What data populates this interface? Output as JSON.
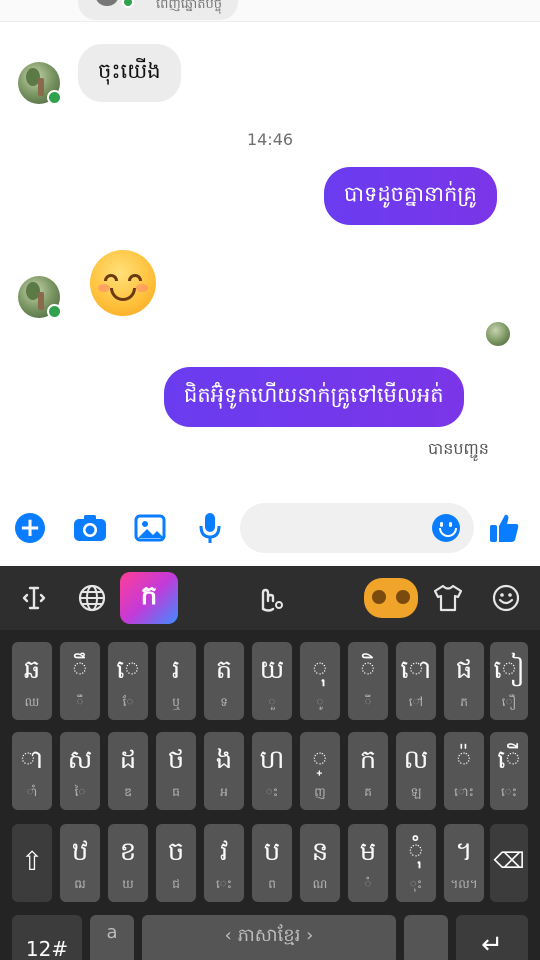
{
  "chat": {
    "top_partial_text": "ពេញឆ្នោតបច្ចុ",
    "incoming_1": "ចុះយើង",
    "time": "14:46",
    "outgoing_1": "បាទដូចគ្នានាក់គ្រូ",
    "incoming_emoji": "smiling-face-with-smiling-eyes",
    "outgoing_2": "ជិតអ៊ុំទូកហើយនាក់គ្រូទៅមើលអត់",
    "status": "បានបញ្ជូន",
    "colors": {
      "outgoing_bubble": "#6a3cf0",
      "incoming_bubble": "#ececec",
      "online": "#31a24c"
    }
  },
  "composer": {
    "input_value": "",
    "icons": [
      "add-icon",
      "camera-icon",
      "image-icon",
      "microphone-icon",
      "emoji-icon",
      "thumbs-up-icon"
    ],
    "accent": "#0a7cff"
  },
  "keyboard": {
    "toolbar_icons": [
      "text-cursor-icon",
      "globe-icon",
      "sticker-icon",
      "gesture-icon",
      "gamepad-icon",
      "theme-shirt-icon",
      "emoji-icon"
    ],
    "sticker_label": "ក",
    "row1": [
      {
        "m": "ឆ",
        "s": "ឈ"
      },
      {
        "m": "ឹ",
        "s": "ឺ"
      },
      {
        "m": "េ",
        "s": "ែ"
      },
      {
        "m": "រ",
        "s": "ឬ"
      },
      {
        "m": "ត",
        "s": "ទ"
      },
      {
        "m": "យ",
        "s": "ួ"
      },
      {
        "m": "ុ",
        "s": "ូ"
      },
      {
        "m": "ិ",
        "s": "ី"
      },
      {
        "m": "ោ",
        "s": "ៅ"
      },
      {
        "m": "ផ",
        "s": "ភ"
      },
      {
        "m": "ៀ",
        "s": "ឿ"
      }
    ],
    "row2": [
      {
        "m": "ា",
        "s": "ាំ"
      },
      {
        "m": "ស",
        "s": "ៃ"
      },
      {
        "m": "ដ",
        "s": "ឌ"
      },
      {
        "m": "ថ",
        "s": "ធ"
      },
      {
        "m": "ង",
        "s": "អ"
      },
      {
        "m": "ហ",
        "s": "ះ"
      },
      {
        "m": "្",
        "s": "ញ"
      },
      {
        "m": "ក",
        "s": "គ"
      },
      {
        "m": "ល",
        "s": "ឡ"
      },
      {
        "m": "៉",
        "s": "ោះ"
      },
      {
        "m": "ើ",
        "s": "េះ"
      }
    ],
    "row3": [
      {
        "m": "ឋ",
        "s": "ឍ"
      },
      {
        "m": "ខ",
        "s": "ឃ"
      },
      {
        "m": "ច",
        "s": "ជ"
      },
      {
        "m": "វ",
        "s": "េះ"
      },
      {
        "m": "ប",
        "s": "ព"
      },
      {
        "m": "ន",
        "s": "ណ"
      },
      {
        "m": "ម",
        "s": "ំ"
      },
      {
        "m": "ុំ",
        "s": "ុះ"
      },
      {
        "m": "។",
        "s": "។ល។"
      }
    ],
    "shift_label": "⇧",
    "backspace_label": "⌫",
    "symbols_label": "12#",
    "extra_key_top": "a",
    "extra_key_bottom": "",
    "space_label": "‹ ភាសាខ្មែរ ›",
    "enter_label": "↵"
  }
}
